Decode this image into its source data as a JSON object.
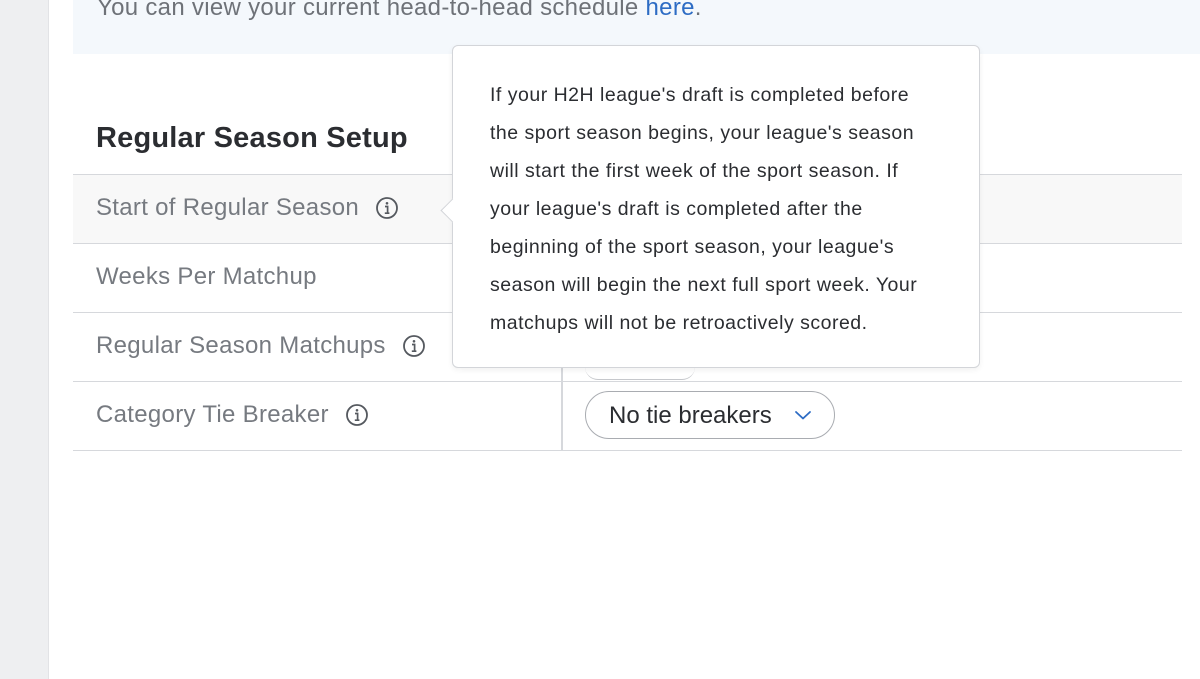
{
  "notice": {
    "text": "You can view your current head-to-head schedule ",
    "link_label": "here",
    "trailing": "."
  },
  "section": {
    "title": "Regular Season Setup"
  },
  "settings": {
    "rows": [
      {
        "label": "Start of Regular Season",
        "has_info": true
      },
      {
        "label": "Weeks Per Matchup",
        "has_info": false
      },
      {
        "label": "Regular Season Matchups",
        "has_info": true
      },
      {
        "label": "Category Tie Breaker",
        "has_info": true
      }
    ],
    "tie_breaker_select": {
      "value": "No tie breakers",
      "icon": "chevron-down-icon"
    }
  },
  "tooltip": {
    "text": "If your H2H league's draft is completed before the sport season begins, your league's season will start the first week of the sport season. If your league's draft is completed after the beginning of the sport season, your league's season will begin the next full sport week. Your matchups will not be retroactively scored."
  },
  "colors": {
    "link": "#2d6cc4",
    "notice_bg": "#f4f8fc",
    "label": "#767a80",
    "title": "#2b2d31",
    "border": "#d6d8dc"
  }
}
